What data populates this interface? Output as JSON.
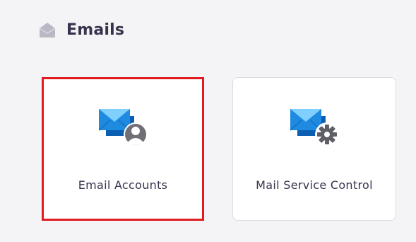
{
  "section": {
    "title": "Emails",
    "icon": "envelope-open-icon"
  },
  "cards": [
    {
      "label": "Email Accounts",
      "icon": "email-accounts-icon",
      "highlighted": true
    },
    {
      "label": "Mail Service Control",
      "icon": "mail-service-control-icon",
      "highlighted": false
    }
  ],
  "colors": {
    "highlight_border": "#e01b22",
    "envelope_blue": "#1e8ae0",
    "envelope_light": "#7fd0ff",
    "envelope_dark": "#0a5fb3",
    "header_icon": "#b9b8c4",
    "text": "#36344d"
  }
}
